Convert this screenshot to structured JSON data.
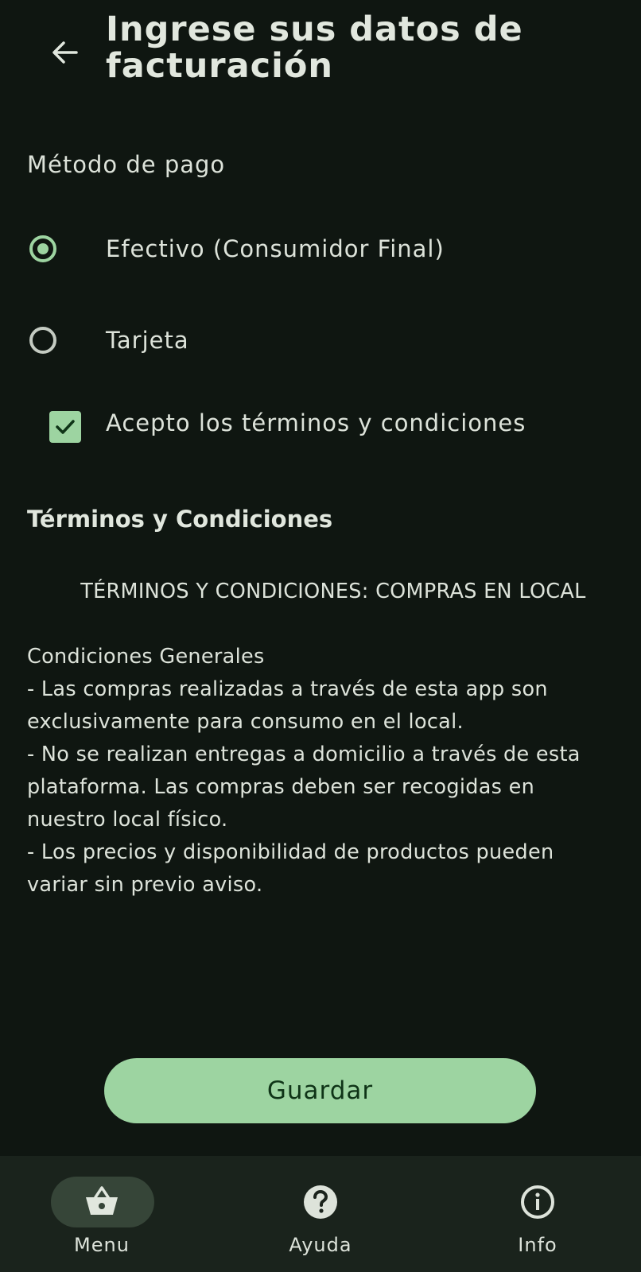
{
  "header": {
    "title": "Ingrese sus datos de facturación",
    "back_icon": "arrow-back-icon"
  },
  "payment": {
    "section_label": "Método de pago",
    "options": [
      {
        "label": "Efectivo (Consumidor Final)",
        "selected": true
      },
      {
        "label": "Tarjeta",
        "selected": false
      }
    ]
  },
  "terms_checkbox": {
    "label": "Acepto los términos y condiciones",
    "checked": true
  },
  "terms": {
    "title": "Términos y Condiciones",
    "body": "        TÉRMINOS Y CONDICIONES: COMPRAS EN LOCAL\n\nCondiciones Generales\n- Las compras realizadas a través de esta app son exclusivamente para consumo en el local.\n- No se realizan entregas a domicilio a través de esta plataforma. Las compras deben ser recogidas en nuestro local físico.\n- Los precios y disponibilidad de productos pueden variar sin previo aviso."
  },
  "actions": {
    "save_label": "Guardar"
  },
  "bottom_nav": {
    "items": [
      {
        "label": "Menu",
        "icon": "basket-icon",
        "active": true
      },
      {
        "label": "Ayuda",
        "icon": "help-icon",
        "active": false
      },
      {
        "label": "Info",
        "icon": "info-icon",
        "active": false
      }
    ]
  },
  "colors": {
    "background": "#0f1611",
    "accent": "#9dd4a1",
    "nav_background": "#1a231c",
    "nav_active_pill": "#364538"
  }
}
